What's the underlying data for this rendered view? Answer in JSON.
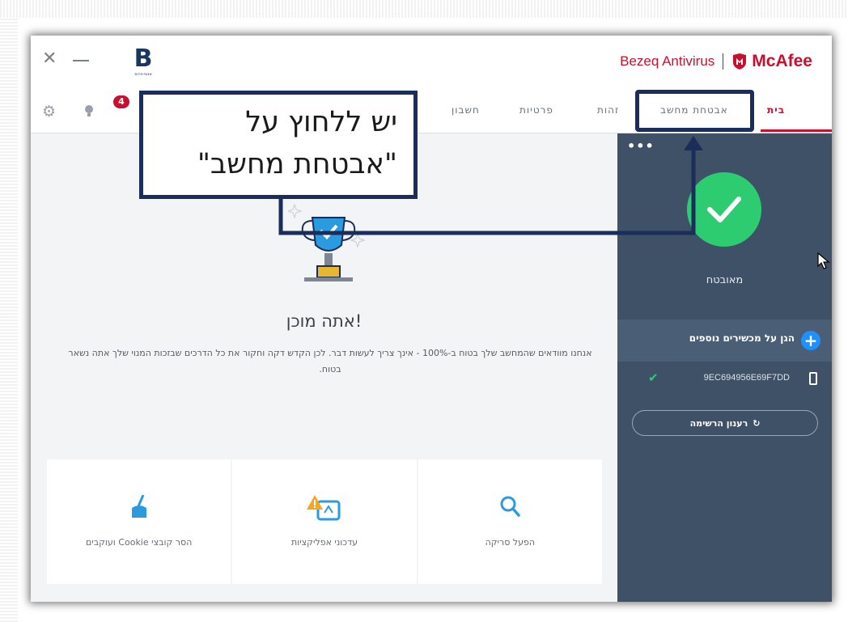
{
  "window": {
    "close_glyph": "✕",
    "brand_bezeq": "Bezeq Antivirus",
    "brand_mcafee": "McAfee",
    "logo_letter": "B",
    "logo_sub": "אנטי-וירוס"
  },
  "nav": {
    "tabs": [
      "בית",
      "אבטחת מחשב",
      "זהות",
      "פרטיות",
      "חשבון"
    ],
    "active_tab": "בית",
    "notification_count": "4"
  },
  "main": {
    "title": "אתה מוכן!",
    "description": "אנחנו מוודאים שהמחשב שלך בטוח ב-100% - אינך צריך לעשות דבר. לכן הקדש דקה וחקור את כל הדרכים שבזכות המנוי שלך אתה נשאר בטוח.",
    "cards": [
      {
        "label": "הסר קובצי Cookie ועוקבים",
        "icon": "broom-icon"
      },
      {
        "label": "עדכוני אפליקציות",
        "icon": "app-update-warning-icon"
      },
      {
        "label": "הפעל סריקה",
        "icon": "search-icon"
      }
    ]
  },
  "sidebar": {
    "more": "•••",
    "status": "מאובטח",
    "protect_more": "הגן על מכשירים נוספים",
    "device_id": "9EC694956E69F7DD",
    "refresh_label": "רענון הרשימה"
  },
  "callout": {
    "line1": "יש ללחוץ על",
    "line2": "\"אבטחת מחשב\""
  },
  "colors": {
    "brand_red": "#c8102e",
    "sidebar_bg": "#3f5166",
    "success_green": "#2ecc71",
    "accent_blue": "#1e90ff",
    "callout_border": "#1b2d5b"
  }
}
